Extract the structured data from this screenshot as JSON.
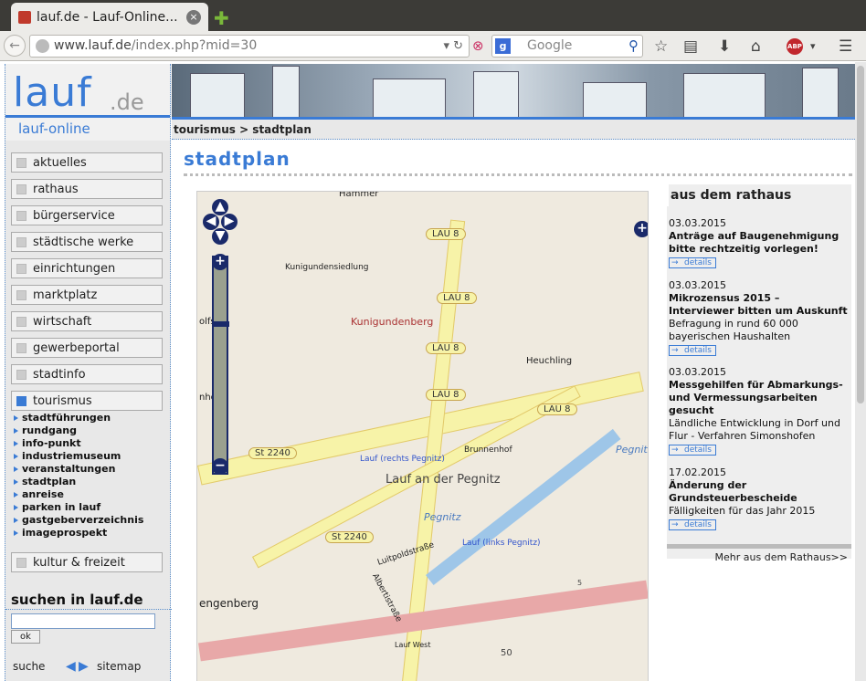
{
  "browser": {
    "tab_title": "lauf.de - Lauf-Online...",
    "url_domain": "www.lauf.de",
    "url_path": "/index.php?mid=30",
    "search_placeholder": "Google"
  },
  "site": {
    "logo_text": "lauf",
    "logo_de": ".de",
    "logo_sub": "lauf-online",
    "breadcrumb": "tourismus > stadtplan",
    "page_title": "stadtplan"
  },
  "menu": [
    {
      "label": "aktuelles"
    },
    {
      "label": "rathaus"
    },
    {
      "label": "bürgerservice"
    },
    {
      "label": "städtische werke"
    },
    {
      "label": "einrichtungen"
    },
    {
      "label": "marktplatz"
    },
    {
      "label": "wirtschaft"
    },
    {
      "label": "gewerbeportal"
    },
    {
      "label": "stadtinfo"
    },
    {
      "label": "tourismus"
    }
  ],
  "submenu": [
    "stadtführungen",
    "rundgang",
    "info-punkt",
    "industriemuseum",
    "veranstaltungen",
    "stadtplan",
    "anreise",
    "parken in lauf",
    "gastgeberverzeichnis",
    "imageprospekt"
  ],
  "menu_after": {
    "label": "kultur & freizeit"
  },
  "search_box": {
    "title": "suchen in lauf.de",
    "ok": "ok",
    "suche": "suche",
    "sitemap": "sitemap"
  },
  "map": {
    "labels": {
      "kunigundensiedlung": "Kunigundensiedlung",
      "kunigundenberg": "Kunigundenberg",
      "heuchling": "Heuchling",
      "brunnenhof": "Brunnenhof",
      "lauf_rechts": "Lauf (rechts Pegnitz)",
      "lauf_an": "Lauf an der Pegnitz",
      "pegnitz1": "Pegnitz",
      "pegnitz2": "Pegnitz",
      "lauf_links": "Lauf (links Pegnitz)",
      "luitpold": "Luitpoldstraße",
      "alberti": "Albertistraße",
      "engenberg": "engenberg",
      "lauf_west": "Lauf West",
      "olfshoehe": "olfsh",
      "nhoh": "nhoh",
      "hammer": "Hammer"
    },
    "shields": {
      "lau8a": "LAU 8",
      "lau8b": "LAU 8",
      "lau8c": "LAU 8",
      "lau8d": "LAU 8",
      "lau8e": "LAU 8",
      "st2240a": "St 2240",
      "st2240b": "St 2240",
      "n50": "50",
      "n5": "5"
    }
  },
  "news_panel": {
    "heading": "aus dem rathaus",
    "more": "Mehr aus dem Rathaus>>",
    "details_label": "details",
    "items": [
      {
        "date": "03.03.2015",
        "headline": "Anträge auf Baugenehmigung bitte rechtzeitig vorlegen!",
        "body": ""
      },
      {
        "date": "03.03.2015",
        "headline": "Mikrozensus 2015 – Interviewer bitten um Auskunft",
        "body": "Befragung in rund 60 000 bayerischen Haushalten"
      },
      {
        "date": "03.03.2015",
        "headline": "Messgehilfen für Abmarkungs- und Vermessungsarbeiten gesucht",
        "body": "Ländliche Entwicklung in Dorf und Flur - Verfahren Simonshofen"
      },
      {
        "date": "17.02.2015",
        "headline": "Änderung der Grundsteuerbescheide",
        "body": "Fälligkeiten für das Jahr 2015"
      }
    ]
  }
}
